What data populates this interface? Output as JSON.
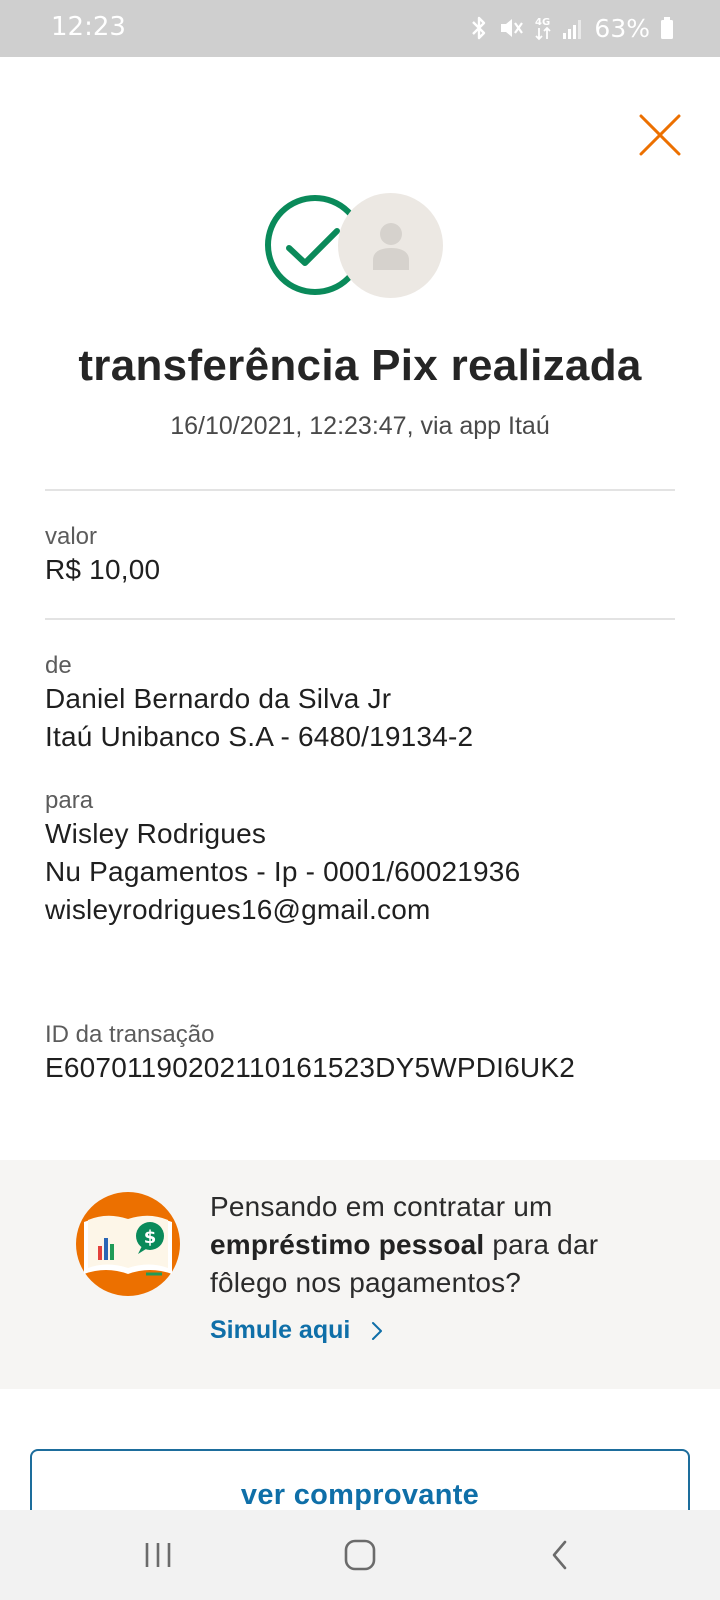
{
  "status_bar": {
    "time": "12:23",
    "battery": "63%",
    "icons": [
      "bluetooth-icon",
      "mute-icon",
      "4g-icon",
      "signal-icon",
      "battery-icon"
    ]
  },
  "header": {
    "close_icon": "close-icon"
  },
  "hero": {
    "check_icon": "check-circle-icon",
    "avatar_icon": "user-avatar-icon",
    "title": "transferência Pix realizada",
    "subtitle": "16/10/2021,  12:23:47, via app Itaú"
  },
  "details": {
    "amount_label": "valor",
    "amount_value": "R$ 10,00",
    "from_label": "de",
    "from_name": "Daniel Bernardo da Silva Jr",
    "from_bank": "Itaú Unibanco S.A - 6480/19134-2",
    "to_label": "para",
    "to_name": "Wisley Rodrigues",
    "to_bank": "Nu Pagamentos - Ip - 0001/60021936",
    "to_key": "wisleyrodrigues16@gmail.com",
    "transaction_label": "ID da transação",
    "transaction_id": "E60701190202110161523DY5WPDI6UK2"
  },
  "promo": {
    "text_before": "Pensando em contratar um",
    "text_bold": "empréstimo pessoal",
    "text_after": "para dar fôlego nos pagamentos?",
    "link_label": "Simule aqui",
    "colors": {
      "circle": "#ec7000",
      "link": "#0f6fa8"
    }
  },
  "actions": {
    "primary_label": "ver comprovante"
  },
  "colors": {
    "accent_orange": "#ec7000",
    "success_green": "#0a8a5a",
    "link_blue": "#0f6fa8"
  }
}
